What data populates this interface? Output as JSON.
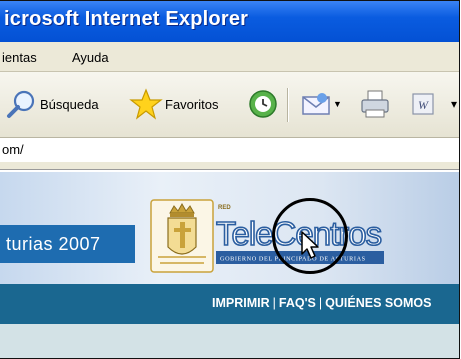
{
  "window": {
    "title": "icrosoft Internet Explorer"
  },
  "menu": {
    "items": [
      "ientas",
      "Ayuda"
    ]
  },
  "toolbar": {
    "search_label": "Búsqueda",
    "favorites_label": "Favoritos"
  },
  "address": {
    "value": "om/"
  },
  "banner": {
    "left_text": "turias 2007",
    "logo_red": "RED",
    "logo_name": "TeleCentros",
    "logo_sub": "GOBIERNO DEL PRINCIPADO DE ASTURIAS"
  },
  "nav": {
    "links": [
      "IMPRIMIR",
      "FAQ'S",
      "QUIÉNES SOMOS"
    ]
  },
  "colors": {
    "titlebar": "#0a5ce0",
    "nav": "#1a6790",
    "brand_blue": "#1e6cb0",
    "logo_gold": "#c9a23a"
  }
}
